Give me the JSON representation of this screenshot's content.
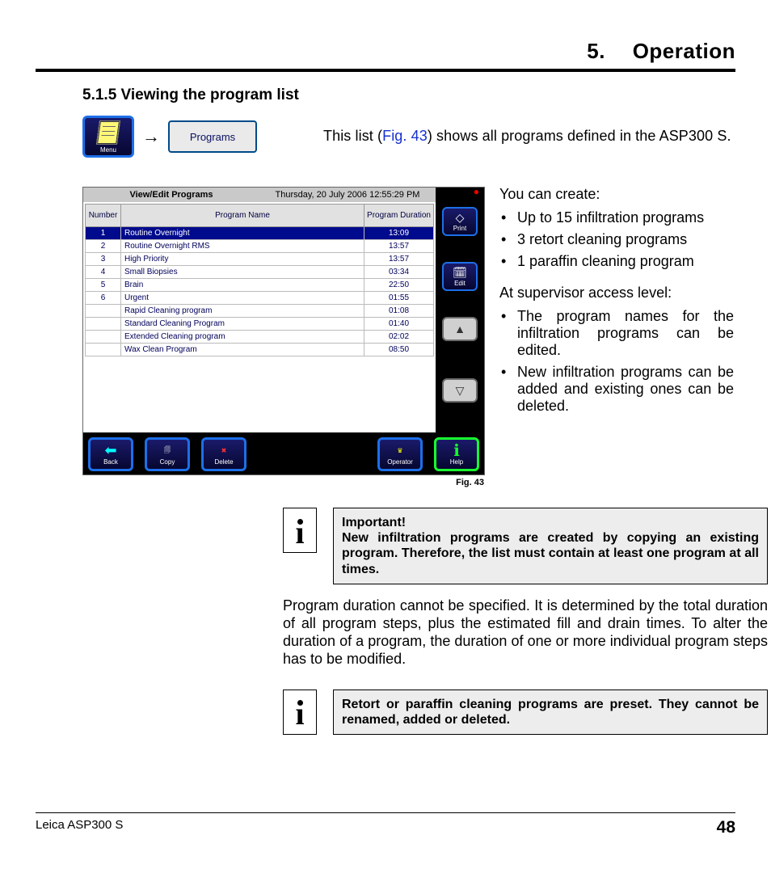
{
  "chapter": {
    "number": "5.",
    "title": "Operation"
  },
  "section": {
    "heading": "5.1.5 Viewing the program list"
  },
  "nav": {
    "menu_label": "Menu",
    "arrow": "→",
    "programs_label": "Programs"
  },
  "intro": {
    "prefix": "This list (",
    "figref": "Fig. 43",
    "suffix": ") shows all programs defined in the ASP300 S."
  },
  "screenshot": {
    "title": "View/Edit Programs",
    "timestamp": "Thursday, 20 July 2006 12:55:29 PM",
    "columns": {
      "number": "Number",
      "name": "Program Name",
      "duration": "Program Duration"
    },
    "rows": [
      {
        "num": "1",
        "name": "Routine Overnight",
        "duration": "13:09",
        "selected": true
      },
      {
        "num": "2",
        "name": "Routine Overnight RMS",
        "duration": "13:57",
        "selected": false
      },
      {
        "num": "3",
        "name": "High Priority",
        "duration": "13:57",
        "selected": false
      },
      {
        "num": "4",
        "name": "Small Biopsies",
        "duration": "03:34",
        "selected": false
      },
      {
        "num": "5",
        "name": "Brain",
        "duration": "22:50",
        "selected": false
      },
      {
        "num": "6",
        "name": "Urgent",
        "duration": "01:55",
        "selected": false
      },
      {
        "num": "",
        "name": "Rapid Cleaning program",
        "duration": "01:08",
        "selected": false
      },
      {
        "num": "",
        "name": "Standard Cleaning Program",
        "duration": "01:40",
        "selected": false
      },
      {
        "num": "",
        "name": "Extended Cleaning program",
        "duration": "02:02",
        "selected": false
      },
      {
        "num": "",
        "name": "Wax Clean Program",
        "duration": "08:50",
        "selected": false
      }
    ],
    "side_buttons": {
      "print": "Print",
      "edit": "Edit",
      "up": "▲",
      "down": "▽"
    },
    "footer_buttons": {
      "back": "Back",
      "copy": "Copy",
      "delete": "Delete",
      "operator": "Operator",
      "help": "Help"
    },
    "caption": "Fig. 43"
  },
  "right": {
    "p1": "You can create:",
    "list1": [
      "Up to 15 infiltration programs",
      "3 retort cleaning programs",
      "1 paraffin cleaning program"
    ],
    "p2": "At supervisor access level:",
    "list2": [
      "The program names for the infiltration programs can be edited.",
      "New infiltration programs can be added and existing ones can be deleted."
    ]
  },
  "notes": {
    "important_title": "Important!",
    "important_body": "New infiltration programs are created by copying an existing program. Therefore, the list must contain at least one program at all times.",
    "paragraph": "Program duration cannot be specified. It is determined by the total duration of all program steps, plus the estimated fill and drain times. To alter the duration of a program, the duration of one or more individual program steps has to be modified.",
    "preset": "Retort or paraffin cleaning programs are preset. They cannot be renamed, added or deleted."
  },
  "footer": {
    "product": "Leica ASP300 S",
    "page": "48"
  }
}
